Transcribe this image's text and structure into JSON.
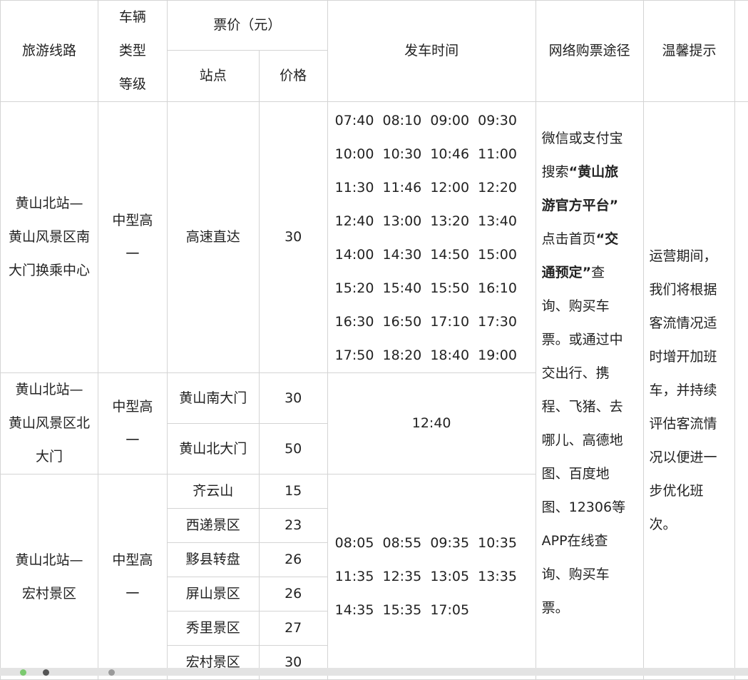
{
  "header": {
    "route": "旅游线路",
    "vehicle_lines": [
      "车辆",
      "类型",
      "等级"
    ],
    "fare": "票价（元）",
    "station": "站点",
    "price": "价格",
    "depart": "发车时间",
    "online": "网络购票途径",
    "tips": "温馨提示"
  },
  "rows": [
    {
      "route_lines": [
        "黄山北站—",
        "黄山风景区南",
        "大门换乘中心"
      ],
      "vehicle_lines": [
        "中型高",
        "一"
      ],
      "stations": [
        {
          "name": "高速直达",
          "price": "30"
        }
      ],
      "times": [
        "07:40  08:10  09:00  09:30",
        "10:00  10:30  10:46  11:00",
        "11:30  11:46  12:00  12:20",
        "12:40  13:00  13:20  13:40",
        "14:00  14:30  14:50  15:00",
        "15:20  15:40  15:50  16:10",
        "16:30  16:50  17:10  17:30",
        "17:50  18:20  18:40  19:00"
      ]
    },
    {
      "route_lines": [
        "黄山北站—",
        "黄山风景区北",
        "大门"
      ],
      "vehicle_lines": [
        "中型高",
        "一"
      ],
      "stations": [
        {
          "name": "黄山南大门",
          "price": "30"
        },
        {
          "name": "黄山北大门",
          "price": "50"
        }
      ],
      "times": [
        "12:40"
      ]
    },
    {
      "route_lines": [
        "黄山北站—",
        "宏村景区"
      ],
      "vehicle_lines": [
        "中型高",
        "一"
      ],
      "stations": [
        {
          "name": "齐云山",
          "price": "15"
        },
        {
          "name": "西递景区",
          "price": "23"
        },
        {
          "name": "黟县转盘",
          "price": "26"
        },
        {
          "name": "屏山景区",
          "price": "26"
        },
        {
          "name": "秀里景区",
          "price": "27"
        },
        {
          "name": "宏村景区",
          "price": "30"
        }
      ],
      "times": [
        "08:05  08:55  09:35  10:35",
        "11:35  12:35  13:05  13:35",
        "14:35  15:35  17:05"
      ]
    }
  ],
  "online_lines": [
    {
      "t1": "微信或支付宝",
      "b": ""
    },
    {
      "t1": "搜索",
      "b": "“黄山旅"
    },
    {
      "t1": "",
      "b": "游官方平台”"
    },
    {
      "t1": "点击首页",
      "b": "“交"
    },
    {
      "t1": "",
      "b": "通预定”",
      "t2": "查"
    },
    {
      "t1": "询、购买车",
      "b": ""
    },
    {
      "t1": "票。或通过中",
      "b": ""
    },
    {
      "t1": "交出行、携",
      "b": ""
    },
    {
      "t1": "程、飞猪、去",
      "b": ""
    },
    {
      "t1": "哪儿、高德地",
      "b": ""
    },
    {
      "t1": "图、百度地",
      "b": ""
    },
    {
      "t1": "图、12306等",
      "b": ""
    },
    {
      "t1": "APP在线查",
      "b": ""
    },
    {
      "t1": "询、购买车",
      "b": ""
    },
    {
      "t1": "票。",
      "b": ""
    }
  ],
  "tips_lines": [
    "运营期间，",
    "我们将根据",
    "客流情况适",
    "时增开加班",
    "车，并持续",
    "评估客流情",
    "况以便进一",
    "步优化班",
    "次。"
  ]
}
